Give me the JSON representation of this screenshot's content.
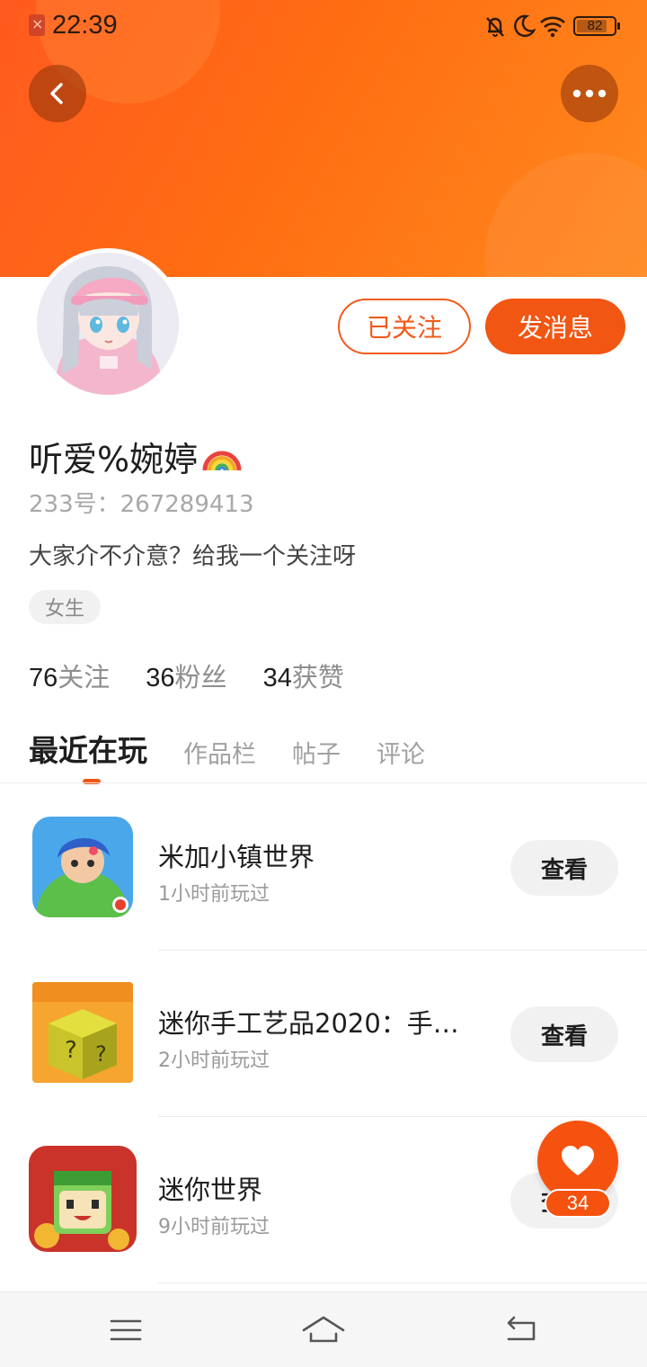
{
  "status_bar": {
    "time": "22:39",
    "battery_level": "82",
    "battery_fraction": 0.82,
    "icons": [
      "sim-missing-icon",
      "mute-bell-icon",
      "moon-icon",
      "wifi-icon",
      "battery-icon"
    ]
  },
  "header": {
    "back_icon": "chevron-left-icon",
    "more_icon": "more-dots-icon",
    "banner_color": "#ff6a14"
  },
  "profile": {
    "username": "听爱%婉婷",
    "username_emoji": "rainbow-emoji",
    "uid": "233号：267289413",
    "bio": "大家介不介意？给我一个关注呀",
    "tag": "女生",
    "follow_label": "已关注",
    "message_label": "发消息"
  },
  "stats": [
    {
      "value": "76",
      "label": "关注"
    },
    {
      "value": "36",
      "label": "粉丝"
    },
    {
      "value": "34",
      "label": "获赞"
    }
  ],
  "tabs": [
    {
      "label": "最近在玩",
      "active": true
    },
    {
      "label": "作品栏",
      "active": false
    },
    {
      "label": "帖子",
      "active": false
    },
    {
      "label": "评论",
      "active": false
    }
  ],
  "games": [
    {
      "title": "米加小镇世界",
      "played": "1小时前玩过",
      "button": "查看"
    },
    {
      "title": "迷你手工艺品2020：手…",
      "played": "2小时前玩过",
      "button": "查看"
    },
    {
      "title": "迷你世界",
      "played": "9小时前玩过",
      "button": "查看"
    }
  ],
  "like_fab": {
    "icon": "heart-icon",
    "count": "34"
  },
  "nav_bar": {
    "icons": [
      "menu-icon",
      "home-icon",
      "back-nav-icon"
    ]
  },
  "colors": {
    "accent": "#f25613",
    "tag_bg": "#f1f1f1",
    "muted_text": "#9a9a9a"
  }
}
